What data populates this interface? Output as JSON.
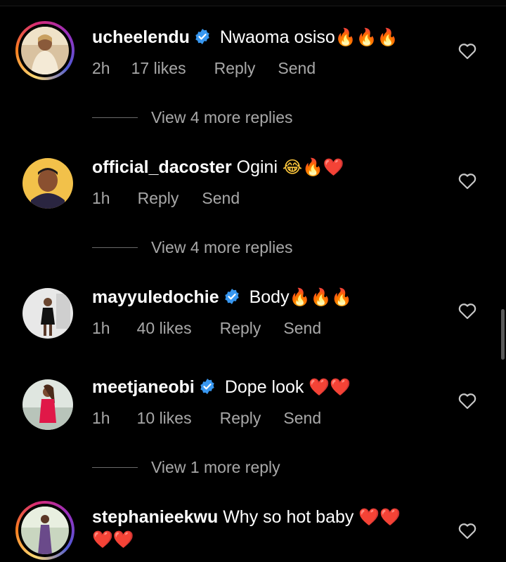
{
  "comments": [
    {
      "username": "ucheelendu",
      "verified": true,
      "text": "Nwaoma osiso",
      "emojis": "🔥🔥🔥",
      "time": "2h",
      "likes": "17 likes",
      "reply": "Reply",
      "send": "Send",
      "more_replies": "View 4 more replies"
    },
    {
      "username": "official_dacoster",
      "verified": false,
      "text": "Ogini",
      "emojis": "😂🔥❤️",
      "time": "1h",
      "reply": "Reply",
      "send": "Send",
      "more_replies": "View 4 more replies"
    },
    {
      "username": "mayyuledochie",
      "verified": true,
      "text": "Body",
      "emojis": "🔥🔥🔥",
      "time": "1h",
      "likes": "40 likes",
      "reply": "Reply",
      "send": "Send"
    },
    {
      "username": "meetjaneobi",
      "verified": true,
      "text": "Dope look",
      "emojis": "❤️❤️",
      "time": "1h",
      "likes": "10 likes",
      "reply": "Reply",
      "send": "Send",
      "more_replies": "View 1 more reply"
    },
    {
      "username": "stephanieekwu",
      "verified": false,
      "text": "Why so hot baby",
      "emojis": "❤️❤️",
      "emojis_line2": "❤️❤️"
    }
  ],
  "colors": {
    "background": "#000000",
    "secondary_text": "#a8a8a8",
    "verified_blue": "#3897f0"
  },
  "icons": {
    "verified": "verified-badge-icon",
    "like": "heart-outline-icon"
  }
}
